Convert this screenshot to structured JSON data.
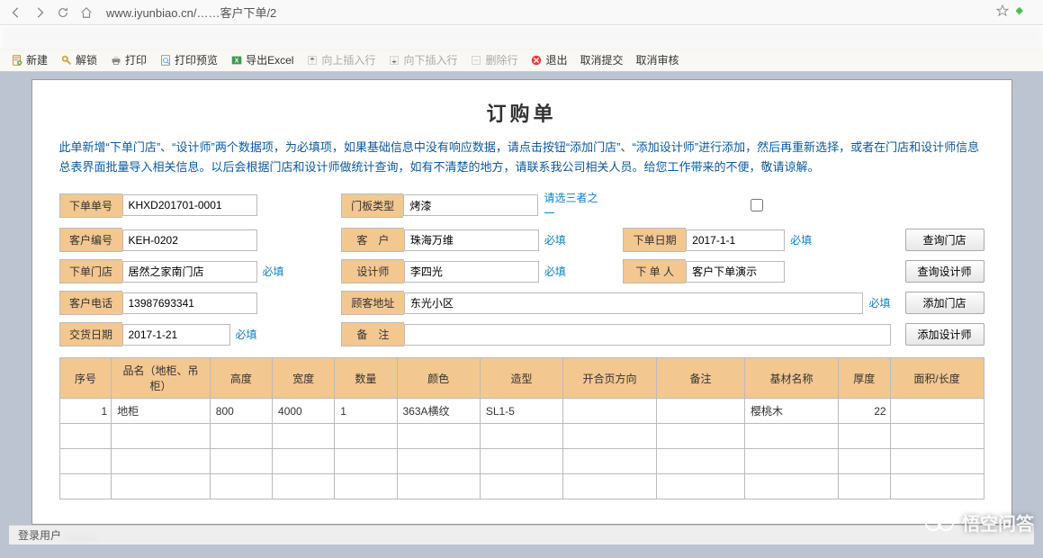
{
  "browser": {
    "url": "www.iyunbiao.cn/……客户下单/2"
  },
  "toolbar": {
    "new": "新建",
    "unlock": "解锁",
    "print": "打印",
    "print_preview": "打印预览",
    "export_excel": "导出Excel",
    "insert_up": "向上插入行",
    "insert_down": "向下插入行",
    "delete_row": "删除行",
    "exit": "退出",
    "cancel_submit": "取消提交",
    "cancel_review": "取消审核"
  },
  "page": {
    "title": "订购单",
    "notice": "此单新增“下单门店”、“设计师”两个数据项，为必填项，如果基础信息中没有响应数据，请点击按钮“添加门店”、“添加设计师”进行添加，然后再重新选择，或者在门店和设计师信息总表界面批量导入相关信息。以后会根据门店和设计师做统计查询，如有不清楚的地方，请联系我公司相关人员。给您工作带来的不便，敬请谅解。"
  },
  "form": {
    "order_no": {
      "label": "下单单号",
      "value": "KHXD201701-0001"
    },
    "panel_type": {
      "label": "门板类型",
      "value": "烤漆",
      "hint": "请选三者之一"
    },
    "cust_code": {
      "label": "客户编号",
      "value": "KEH-0202"
    },
    "customer": {
      "label": "客　户",
      "value": "珠海万维",
      "req": "必填"
    },
    "order_date": {
      "label": "下单日期",
      "value": "2017-1-1",
      "req": "必填"
    },
    "store": {
      "label": "下单门店",
      "value": "居然之家南门店",
      "req": "必填"
    },
    "designer": {
      "label": "设计师",
      "value": "李四光",
      "req": "必填"
    },
    "order_by": {
      "label": "下 单 人",
      "value": "客户下单演示"
    },
    "cust_phone": {
      "label": "客户电话",
      "value": "13987693341"
    },
    "cust_addr": {
      "label": "顾客地址",
      "value": "东光小区",
      "req": "必填"
    },
    "deliver_date": {
      "label": "交货日期",
      "value": "2017-1-21",
      "req": "必填"
    },
    "remark": {
      "label": "备　注",
      "value": ""
    }
  },
  "buttons": {
    "query_store": "查询门店",
    "query_designer": "查询设计师",
    "add_store": "添加门店",
    "add_designer": "添加设计师"
  },
  "table": {
    "headers": [
      "序号",
      "品名（地柜、吊柜）",
      "高度",
      "宽度",
      "数量",
      "颜色",
      "造型",
      "开合页方向",
      "备注",
      "基材名称",
      "厚度",
      "面积/长度"
    ],
    "rows": [
      [
        "1",
        "地柜",
        "800",
        "4000",
        "1",
        "363A横纹",
        "SL1-5",
        "",
        "",
        "樱桃木",
        "22",
        ""
      ],
      [
        "",
        "",
        "",
        "",
        "",
        "",
        "",
        "",
        "",
        "",
        "",
        ""
      ],
      [
        "",
        "",
        "",
        "",
        "",
        "",
        "",
        "",
        "",
        "",
        "",
        ""
      ],
      [
        "",
        "",
        "",
        "",
        "",
        "",
        "",
        "",
        "",
        "",
        "",
        ""
      ]
    ]
  },
  "status": {
    "user_label": "登录用户"
  },
  "watermark": "悟空问答"
}
